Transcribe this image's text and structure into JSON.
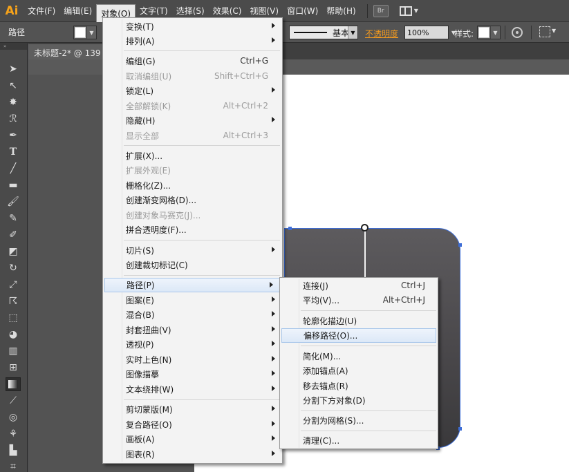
{
  "app": {
    "logo": "Ai"
  },
  "menubar": {
    "items": [
      "文件(F)",
      "编辑(E)",
      "对象(O)",
      "文字(T)",
      "选择(S)",
      "效果(C)",
      "视图(V)",
      "窗口(W)",
      "帮助(H)"
    ],
    "active_index": 2,
    "bridge_label": "Br"
  },
  "controlbar": {
    "selection_label": "路径",
    "stroke_style": "基本",
    "opacity_label": "不透明度",
    "opacity_value": "100%",
    "style_label": "样式:",
    "accent_color": "#f29a1f"
  },
  "document": {
    "tab_title": "未标题-2* @ 139"
  },
  "object_menu": {
    "items": [
      {
        "label": "变换(T)",
        "shortcut": "",
        "submenu": true,
        "enabled": true
      },
      {
        "label": "排列(A)",
        "shortcut": "",
        "submenu": true,
        "enabled": true
      },
      {
        "label": "编组(G)",
        "shortcut": "Ctrl+G",
        "submenu": false,
        "enabled": true
      },
      {
        "label": "取消编组(U)",
        "shortcut": "Shift+Ctrl+G",
        "submenu": false,
        "enabled": false
      },
      {
        "label": "锁定(L)",
        "shortcut": "",
        "submenu": true,
        "enabled": true
      },
      {
        "label": "全部解锁(K)",
        "shortcut": "Alt+Ctrl+2",
        "submenu": false,
        "enabled": false
      },
      {
        "label": "隐藏(H)",
        "shortcut": "",
        "submenu": true,
        "enabled": true
      },
      {
        "label": "显示全部",
        "shortcut": "Alt+Ctrl+3",
        "submenu": false,
        "enabled": false
      },
      {
        "label": "扩展(X)...",
        "shortcut": "",
        "submenu": false,
        "enabled": true
      },
      {
        "label": "扩展外观(E)",
        "shortcut": "",
        "submenu": false,
        "enabled": false
      },
      {
        "label": "栅格化(Z)...",
        "shortcut": "",
        "submenu": false,
        "enabled": true
      },
      {
        "label": "创建渐变网格(D)...",
        "shortcut": "",
        "submenu": false,
        "enabled": true
      },
      {
        "label": "创建对象马赛克(J)...",
        "shortcut": "",
        "submenu": false,
        "enabled": false
      },
      {
        "label": "拼合透明度(F)...",
        "shortcut": "",
        "submenu": false,
        "enabled": true
      },
      {
        "label": "切片(S)",
        "shortcut": "",
        "submenu": true,
        "enabled": true
      },
      {
        "label": "创建裁切标记(C)",
        "shortcut": "",
        "submenu": false,
        "enabled": true
      },
      {
        "label": "路径(P)",
        "shortcut": "",
        "submenu": true,
        "enabled": true,
        "highlighted": true
      },
      {
        "label": "图案(E)",
        "shortcut": "",
        "submenu": true,
        "enabled": true
      },
      {
        "label": "混合(B)",
        "shortcut": "",
        "submenu": true,
        "enabled": true
      },
      {
        "label": "封套扭曲(V)",
        "shortcut": "",
        "submenu": true,
        "enabled": true
      },
      {
        "label": "透视(P)",
        "shortcut": "",
        "submenu": true,
        "enabled": true
      },
      {
        "label": "实时上色(N)",
        "shortcut": "",
        "submenu": true,
        "enabled": true
      },
      {
        "label": "图像描摹",
        "shortcut": "",
        "submenu": true,
        "enabled": true
      },
      {
        "label": "文本绕排(W)",
        "shortcut": "",
        "submenu": true,
        "enabled": true
      },
      {
        "label": "剪切蒙版(M)",
        "shortcut": "",
        "submenu": true,
        "enabled": true
      },
      {
        "label": "复合路径(O)",
        "shortcut": "",
        "submenu": true,
        "enabled": true
      },
      {
        "label": "画板(A)",
        "shortcut": "",
        "submenu": true,
        "enabled": true
      },
      {
        "label": "图表(R)",
        "shortcut": "",
        "submenu": true,
        "enabled": true
      }
    ]
  },
  "path_menu": {
    "items": [
      {
        "label": "连接(J)",
        "shortcut": "Ctrl+J"
      },
      {
        "label": "平均(V)...",
        "shortcut": "Alt+Ctrl+J"
      },
      {
        "label": "轮廓化描边(U)",
        "shortcut": ""
      },
      {
        "label": "偏移路径(O)...",
        "shortcut": "",
        "highlighted": true
      },
      {
        "label": "简化(M)...",
        "shortcut": ""
      },
      {
        "label": "添加锚点(A)",
        "shortcut": ""
      },
      {
        "label": "移去锚点(R)",
        "shortcut": ""
      },
      {
        "label": "分割下方对象(D)",
        "shortcut": ""
      },
      {
        "label": "分割为网格(S)...",
        "shortcut": ""
      },
      {
        "label": "清理(C)...",
        "shortcut": ""
      }
    ]
  },
  "tools": [
    "selection-tool",
    "direct-selection-tool",
    "magic-wand-tool",
    "lasso-tool",
    "pen-tool",
    "type-tool",
    "line-tool",
    "rectangle-tool",
    "paintbrush-tool",
    "pencil-tool",
    "blob-brush-tool",
    "eraser-tool",
    "rotate-tool",
    "scale-tool",
    "warp-tool",
    "free-transform-tool",
    "shape-builder-tool",
    "perspective-grid-tool",
    "mesh-tool",
    "gradient-tool",
    "eyedropper-tool",
    "blend-tool",
    "symbol-sprayer-tool",
    "column-graph-tool",
    "artboard-tool"
  ]
}
